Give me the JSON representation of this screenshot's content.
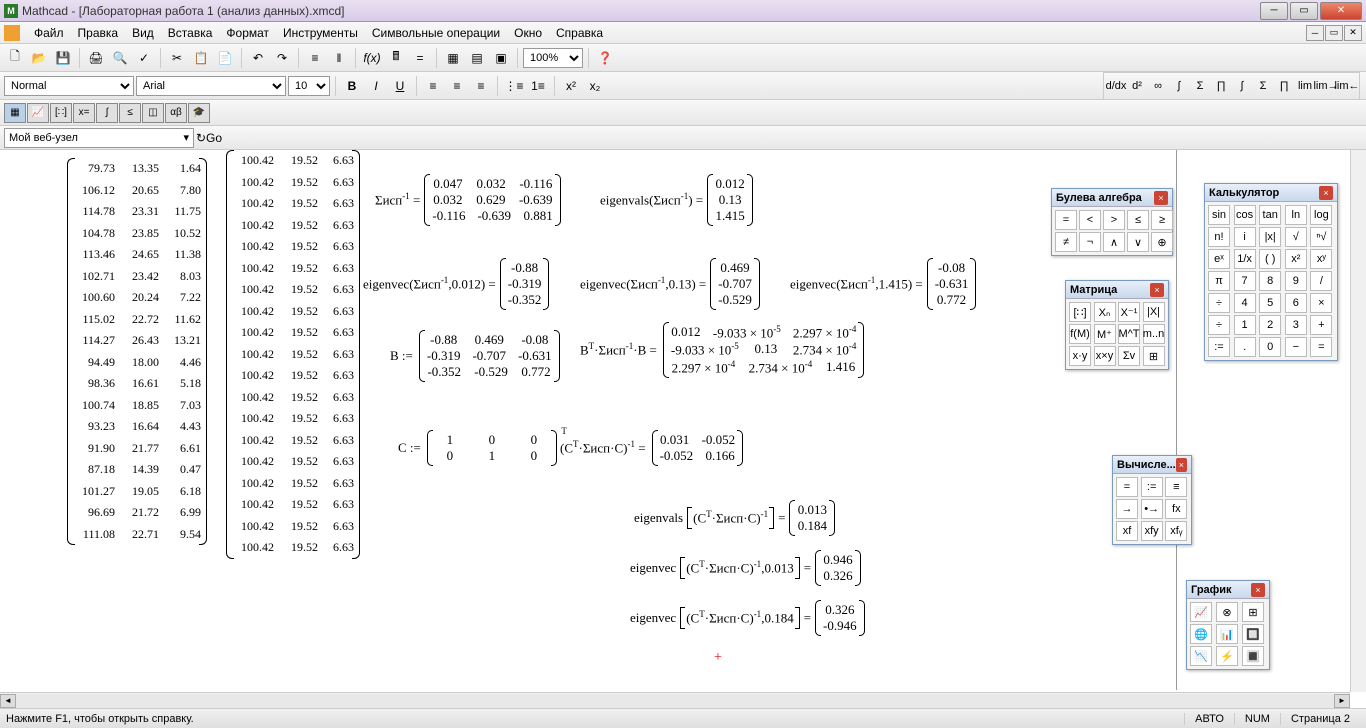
{
  "app": {
    "title": "Mathcad - [Лабораторная работа 1 (анализ данных).xmcd]",
    "icon_letter": "M"
  },
  "menu": {
    "items": [
      "Файл",
      "Правка",
      "Вид",
      "Вставка",
      "Формат",
      "Инструменты",
      "Символьные операции",
      "Окно",
      "Справка"
    ]
  },
  "toolbar1": {
    "zoom": "100%"
  },
  "formatbar": {
    "style": "Normal",
    "font": "Arial",
    "size": "10"
  },
  "webbar": {
    "label": "Мой веб-узел",
    "go": "Go"
  },
  "data_left": [
    [
      "79.73",
      "13.35",
      "1.64"
    ],
    [
      "106.12",
      "20.65",
      "7.80"
    ],
    [
      "114.78",
      "23.31",
      "11.75"
    ],
    [
      "104.78",
      "23.85",
      "10.52"
    ],
    [
      "113.46",
      "24.65",
      "11.38"
    ],
    [
      "102.71",
      "23.42",
      "8.03"
    ],
    [
      "100.60",
      "20.24",
      "7.22"
    ],
    [
      "115.02",
      "22.72",
      "11.62"
    ],
    [
      "114.27",
      "26.43",
      "13.21"
    ],
    [
      "94.49",
      "18.00",
      "4.46"
    ],
    [
      "98.36",
      "16.61",
      "5.18"
    ],
    [
      "100.74",
      "18.85",
      "7.03"
    ],
    [
      "93.23",
      "16.64",
      "4.43"
    ],
    [
      "91.90",
      "21.77",
      "6.61"
    ],
    [
      "87.18",
      "14.39",
      "0.47"
    ],
    [
      "101.27",
      "19.05",
      "6.18"
    ],
    [
      "96.69",
      "21.72",
      "6.99"
    ],
    [
      "111.08",
      "22.71",
      "9.54"
    ]
  ],
  "data_right_row": [
    "100.42",
    "19.52",
    "6.63"
  ],
  "data_right_count": 19,
  "math": {
    "sigma_inv_label": "Σисп",
    "sigma_inv_exp": "-1",
    "sigma_inv": [
      [
        "0.047",
        "0.032",
        "-0.116"
      ],
      [
        "0.032",
        "0.629",
        "-0.639"
      ],
      [
        "-0.116",
        "-0.639",
        "0.881"
      ]
    ],
    "eigenvals_label": "eigenvals",
    "eigenvals1": [
      "0.012",
      "0.13",
      "1.415"
    ],
    "eigenvec_label": "eigenvec",
    "ev012": [
      "-0.88",
      "-0.319",
      "-0.352"
    ],
    "ev013": [
      "0.469",
      "-0.707",
      "-0.529"
    ],
    "ev1415": [
      "-0.08",
      "-0.631",
      "0.772"
    ],
    "B_label": "B",
    "B": [
      [
        "-0.88",
        "0.469",
        "-0.08"
      ],
      [
        "-0.319",
        "-0.707",
        "-0.631"
      ],
      [
        "-0.352",
        "-0.529",
        "0.772"
      ]
    ],
    "BT_label": "B",
    "BT_sup": "T",
    "BTresult": [
      [
        "0.012",
        "-9.033 × 10",
        "2.297 × 10"
      ],
      [
        "-9.033 × 10",
        "0.13",
        "2.734 × 10"
      ],
      [
        "2.297 × 10",
        "2.734 × 10",
        "1.416"
      ]
    ],
    "BT_exps": [
      [
        "",
        "-5",
        "-4"
      ],
      [
        "-5",
        "",
        "-4"
      ],
      [
        "-4",
        "-4",
        ""
      ]
    ],
    "C_label": "C",
    "C": [
      [
        "1",
        "0",
        "0"
      ],
      [
        "0",
        "1",
        "0"
      ]
    ],
    "C_T": "T",
    "Cres": [
      [
        "0.031",
        "-0.052"
      ],
      [
        "-0.052",
        "0.166"
      ]
    ],
    "eig2vals": [
      "0.013",
      "0.184"
    ],
    "eig2vec1": [
      "0.946",
      "0.326"
    ],
    "eig2vec2": [
      "0.326",
      "-0.946"
    ],
    "args": {
      "a012": "0.012",
      "a013": "0.13",
      "a1415": "1.415",
      "a0013": "0.013",
      "a0184": "0.184"
    }
  },
  "palettes": {
    "boolean": {
      "title": "Булева алгебра",
      "btns": [
        "=",
        "<",
        ">",
        "≤",
        "≥",
        "≠",
        "¬",
        "∧",
        "∨",
        "⊕"
      ]
    },
    "matrix": {
      "title": "Матрица",
      "btns": [
        "[∷]",
        "Xₙ",
        "X⁻¹",
        "|X|",
        "f(M)",
        "M⁺",
        "M^T",
        "m..n",
        "x·y",
        "x×y",
        "Σv",
        "⊞"
      ]
    },
    "calc": {
      "title": "Калькулятор",
      "btns": [
        "sin",
        "cos",
        "tan",
        "ln",
        "log",
        "n!",
        "i",
        "|x|",
        "√",
        "ⁿ√",
        "eˣ",
        "1/x",
        "( )",
        "x²",
        "xʸ",
        "π",
        "7",
        "8",
        "9",
        "/",
        "÷",
        "4",
        "5",
        "6",
        "×",
        "÷",
        "1",
        "2",
        "3",
        "+",
        ":=",
        ".",
        "0",
        "−",
        "="
      ]
    },
    "eval": {
      "title": "Вычисле...",
      "btns": [
        "=",
        ":=",
        "≡",
        "→",
        "•→",
        "fx",
        "xf",
        "xfy",
        "xfᵧ"
      ]
    },
    "graph": {
      "title": "График",
      "btns": [
        "📈",
        "⊗",
        "⊞",
        "🌐",
        "📊",
        "🔲",
        "📉",
        "⚡",
        "🔳"
      ]
    }
  },
  "status": {
    "hint": "Нажмите F1, чтобы открыть справку.",
    "mode": "АВТО",
    "num": "NUM",
    "page": "Страница 2"
  }
}
